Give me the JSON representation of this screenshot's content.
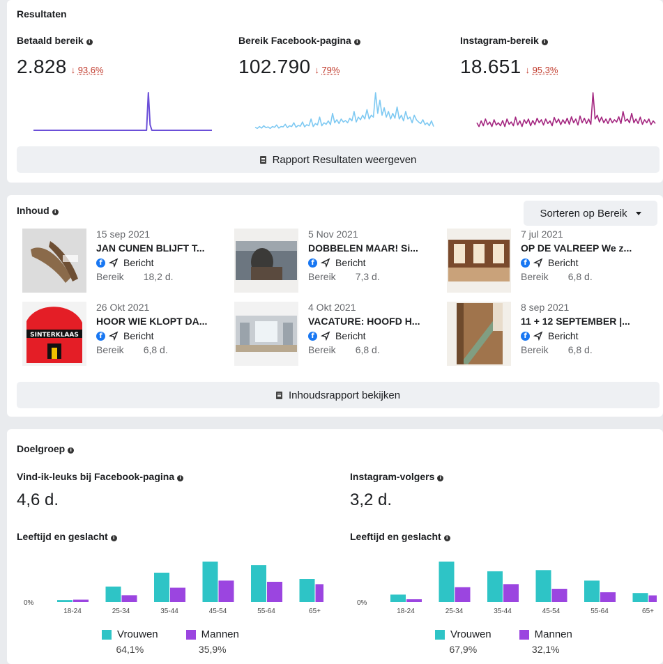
{
  "results": {
    "title": "Resultaten",
    "metrics": [
      {
        "label": "Betaald bereik",
        "value": "2.828",
        "arrow": "↓",
        "delta": "93,6%",
        "color": "#6b4fd8",
        "series": [
          0,
          0,
          0,
          0,
          0,
          0,
          0,
          0,
          0,
          0,
          0,
          0,
          0,
          0,
          0,
          0,
          0,
          0,
          0,
          0,
          0,
          0,
          0,
          0,
          0,
          0,
          0,
          0,
          0,
          0,
          0,
          0,
          0,
          0,
          0,
          0,
          0,
          0,
          0,
          0,
          0,
          0,
          0,
          0,
          0,
          0,
          0,
          0,
          0,
          0,
          0,
          0,
          0,
          0,
          0,
          0,
          0,
          0,
          0,
          0,
          0,
          0,
          0,
          0,
          0,
          1,
          0.15,
          0,
          0,
          0,
          0,
          0,
          0,
          0,
          0,
          0,
          0,
          0,
          0,
          0,
          0,
          0,
          0,
          0,
          0,
          0,
          0,
          0,
          0,
          0,
          0,
          0,
          0,
          0,
          0,
          0,
          0,
          0,
          0,
          0,
          0,
          0
        ]
      },
      {
        "label": "Bereik Facebook-pagina",
        "value": "102.790",
        "arrow": "↓",
        "delta": "79%",
        "color": "#7ec9f2",
        "series": [
          0.08,
          0.05,
          0.1,
          0.06,
          0.12,
          0.07,
          0.09,
          0.05,
          0.1,
          0.08,
          0.14,
          0.06,
          0.1,
          0.09,
          0.16,
          0.07,
          0.12,
          0.1,
          0.2,
          0.08,
          0.13,
          0.11,
          0.22,
          0.09,
          0.15,
          0.12,
          0.3,
          0.1,
          0.18,
          0.14,
          0.35,
          0.12,
          0.2,
          0.16,
          0.25,
          0.15,
          0.45,
          0.2,
          0.28,
          0.18,
          0.3,
          0.22,
          0.26,
          0.2,
          0.32,
          0.25,
          0.5,
          0.22,
          0.35,
          0.28,
          0.4,
          0.3,
          0.55,
          0.3,
          0.4,
          0.35,
          1,
          0.45,
          0.8,
          0.4,
          0.6,
          0.35,
          0.5,
          0.3,
          0.45,
          0.32,
          0.62,
          0.3,
          0.4,
          0.25,
          0.5,
          0.3,
          0.35,
          0.2,
          0.4,
          0.28,
          0.22,
          0.18,
          0.28,
          0.15,
          0.2,
          0.12,
          0.25,
          0.1
        ]
      },
      {
        "label": "Instagram-bereik",
        "value": "18.651",
        "arrow": "↓",
        "delta": "95,3%",
        "color": "#a3257f",
        "series": [
          0.2,
          0.1,
          0.25,
          0.12,
          0.3,
          0.15,
          0.22,
          0.1,
          0.28,
          0.14,
          0.2,
          0.12,
          0.26,
          0.1,
          0.3,
          0.16,
          0.22,
          0.12,
          0.35,
          0.14,
          0.25,
          0.1,
          0.28,
          0.18,
          0.3,
          0.12,
          0.26,
          0.15,
          0.32,
          0.2,
          0.28,
          0.14,
          0.3,
          0.18,
          0.25,
          0.12,
          0.34,
          0.2,
          0.3,
          0.15,
          0.28,
          0.18,
          0.32,
          0.16,
          0.36,
          0.2,
          0.3,
          0.14,
          0.38,
          0.2,
          0.32,
          0.18,
          0.3,
          0.16,
          1,
          0.3,
          0.4,
          0.22,
          0.35,
          0.2,
          0.3,
          0.18,
          0.32,
          0.2,
          0.28,
          0.22,
          0.36,
          0.18,
          0.5,
          0.24,
          0.3,
          0.2,
          0.45,
          0.2,
          0.3,
          0.18,
          0.35,
          0.16,
          0.28,
          0.2,
          0.3,
          0.15,
          0.25,
          0.18
        ]
      }
    ],
    "report_button": "Rapport Resultaten weergeven"
  },
  "content": {
    "title": "Inhoud",
    "sort_label": "Sorteren op Bereik",
    "posts": [
      {
        "date": "15 sep 2021",
        "title": "JAN CUNEN BLIJFT T...",
        "type": "Bericht",
        "reach_label": "Bereik",
        "reach": "18,2 d."
      },
      {
        "date": "5 Nov 2021",
        "title": "DOBBELEN MAAR! Si...",
        "type": "Bericht",
        "reach_label": "Bereik",
        "reach": "7,3 d."
      },
      {
        "date": "7 jul 2021",
        "title": "OP DE VALREEP We z...",
        "type": "Bericht",
        "reach_label": "Bereik",
        "reach": "6,8 d."
      },
      {
        "date": "26 Okt 2021",
        "title": "HOOR WIE KLOPT DA...",
        "type": "Bericht",
        "reach_label": "Bereik",
        "reach": "6,8 d."
      },
      {
        "date": "4 Okt 2021",
        "title": "VACATURE: HOOFD H...",
        "type": "Bericht",
        "reach_label": "Bereik",
        "reach": "6,8 d."
      },
      {
        "date": "8 sep 2021",
        "title": "11 + 12 SEPTEMBER |...",
        "type": "Bericht",
        "reach_label": "Bereik",
        "reach": "6,8 d."
      }
    ],
    "thumb_text": "SINTERKLAAS",
    "report_button": "Inhoudsrapport bekijken"
  },
  "audience": {
    "title": "Doelgroep",
    "facebook": {
      "label": "Vind-ik-leuks bij Facebook-pagina",
      "value": "4,6 d.",
      "chart_title": "Leeftijd en geslacht"
    },
    "instagram": {
      "label": "Instagram-volgers",
      "value": "3,2 d.",
      "chart_title": "Leeftijd en geslacht"
    }
  },
  "chart_data": [
    {
      "type": "bar",
      "title": "Leeftijd en geslacht",
      "categories": [
        "18-24",
        "25-34",
        "35-44",
        "45-54",
        "55-64",
        "65+"
      ],
      "y_tick": "0%",
      "series": [
        {
          "name": "Vrouwen",
          "color": "#2ec4c6",
          "values": [
            0.5,
            3.9,
            7.4,
            10.2,
            9.3,
            5.8
          ],
          "total": "64,1%"
        },
        {
          "name": "Mannen",
          "color": "#9b45e0",
          "values": [
            0.6,
            1.7,
            3.6,
            5.4,
            5.1,
            4.5
          ],
          "total": "35,9%"
        }
      ]
    },
    {
      "type": "bar",
      "title": "Leeftijd en geslacht",
      "categories": [
        "18-24",
        "25-34",
        "35-44",
        "45-54",
        "55-64",
        "65+"
      ],
      "y_tick": "0%",
      "series": [
        {
          "name": "Vrouwen",
          "color": "#2ec4c6",
          "values": [
            1.9,
            10.4,
            7.9,
            8.2,
            5.5,
            2.3
          ],
          "total": "67,9%"
        },
        {
          "name": "Mannen",
          "color": "#9b45e0",
          "values": [
            0.7,
            3.8,
            4.6,
            3.4,
            2.5,
            1.7
          ],
          "total": "32,1%"
        }
      ]
    }
  ]
}
